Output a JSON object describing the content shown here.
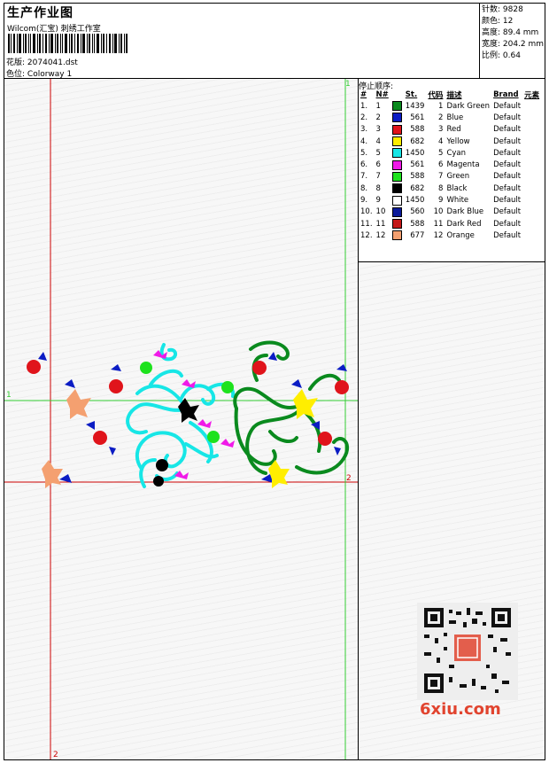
{
  "header": {
    "title": "生产作业图",
    "subtitle": "Wilcom(汇宝) 刺绣工作室",
    "design_label": "花版:",
    "design_value": "2074041.dst",
    "colorway_label": "色位:",
    "colorway_value": "Colorway 1"
  },
  "stats": {
    "stitches": "针数: 9828",
    "colors": "颜色: 12",
    "height": "高度: 89.4 mm",
    "width": "宽度: 204.2 mm",
    "scale": "比例: 0.64"
  },
  "sequence": {
    "title": "停止顺序:",
    "headers": [
      "#",
      "N#",
      "St.",
      "代码",
      "描述",
      "Brand",
      "元素"
    ],
    "rows": [
      {
        "n": "1.",
        "nn": "1",
        "color": "#0a8a1e",
        "st": "1439",
        "code": "1",
        "desc": "Dark Green",
        "brand": "Default"
      },
      {
        "n": "2.",
        "nn": "2",
        "color": "#0b1cc4",
        "st": "561",
        "code": "2",
        "desc": "Blue",
        "brand": "Default"
      },
      {
        "n": "3.",
        "nn": "3",
        "color": "#e0141b",
        "st": "588",
        "code": "3",
        "desc": "Red",
        "brand": "Default"
      },
      {
        "n": "4.",
        "nn": "4",
        "color": "#ffee00",
        "st": "682",
        "code": "4",
        "desc": "Yellow",
        "brand": "Default"
      },
      {
        "n": "5.",
        "nn": "5",
        "color": "#17e6e6",
        "st": "1450",
        "code": "5",
        "desc": "Cyan",
        "brand": "Default"
      },
      {
        "n": "6.",
        "nn": "6",
        "color": "#f01ae8",
        "st": "561",
        "code": "6",
        "desc": "Magenta",
        "brand": "Default"
      },
      {
        "n": "7.",
        "nn": "7",
        "color": "#1de21d",
        "st": "588",
        "code": "7",
        "desc": "Green",
        "brand": "Default"
      },
      {
        "n": "8.",
        "nn": "8",
        "color": "#000000",
        "st": "682",
        "code": "8",
        "desc": "Black",
        "brand": "Default"
      },
      {
        "n": "9.",
        "nn": "9",
        "color": "#ffffff",
        "st": "1450",
        "code": "9",
        "desc": "White",
        "brand": "Default"
      },
      {
        "n": "10.",
        "nn": "10",
        "color": "#0b1a9a",
        "st": "560",
        "code": "10",
        "desc": "Dark Blue",
        "brand": "Default"
      },
      {
        "n": "11.",
        "nn": "11",
        "color": "#c41818",
        "st": "588",
        "code": "11",
        "desc": "Dark Red",
        "brand": "Default"
      },
      {
        "n": "12.",
        "nn": "12",
        "color": "#f4a070",
        "st": "677",
        "code": "12",
        "desc": "Orange",
        "brand": "Default"
      }
    ]
  },
  "guides": {
    "label_1": "1",
    "label_2": "2",
    "label_1b": "1",
    "label_2b": "2"
  },
  "watermark": {
    "text": "6xiu.com"
  },
  "colors": {
    "guide_red": "#cc0000",
    "guide_green": "#33cc33"
  }
}
